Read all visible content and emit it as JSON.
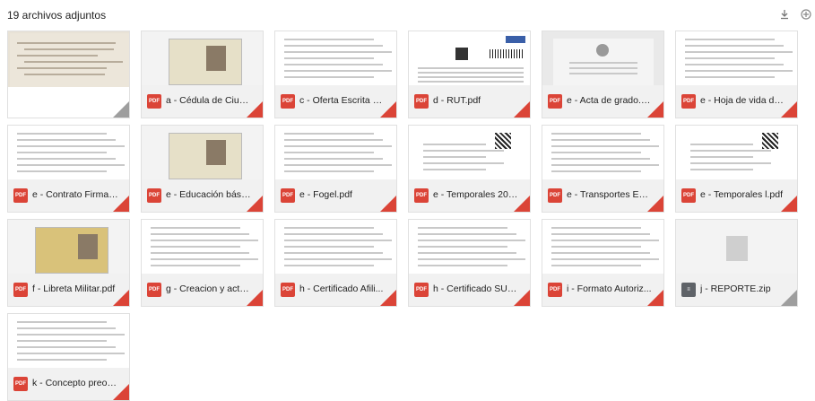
{
  "header": {
    "title": "19 archivos adjuntos",
    "download_icon": "download-icon",
    "drive_icon": "add-to-drive-icon"
  },
  "colors": {
    "pdf": "#db4437",
    "zip": "#5f6368",
    "card_bar": "#f1f1f1"
  },
  "attachments": [
    {
      "name": "",
      "type": "image",
      "thumb": "certificacion-bancaria"
    },
    {
      "name": "a - Cédula de Ciuda...",
      "type": "pdf",
      "thumb": "cedula"
    },
    {
      "name": "c - Oferta Escrita S...",
      "type": "pdf",
      "thumb": "doc"
    },
    {
      "name": "d - RUT.pdf",
      "type": "pdf",
      "thumb": "rut"
    },
    {
      "name": "e - Acta de grado.pdf",
      "type": "pdf",
      "thumb": "acta"
    },
    {
      "name": "e - Hoja de vida del...",
      "type": "pdf",
      "thumb": "form"
    },
    {
      "name": "e - Contrato Firmad...",
      "type": "pdf",
      "thumb": "form"
    },
    {
      "name": "e - Educación básic...",
      "type": "pdf",
      "thumb": "diploma"
    },
    {
      "name": "e - Fogel.pdf",
      "type": "pdf",
      "thumb": "doc"
    },
    {
      "name": "e - Temporales 202...",
      "type": "pdf",
      "thumb": "doc-qr"
    },
    {
      "name": "e - Transportes Esp...",
      "type": "pdf",
      "thumb": "doc"
    },
    {
      "name": "e - Temporales l.pdf",
      "type": "pdf",
      "thumb": "doc-qr"
    },
    {
      "name": "f - Libreta Militar.pdf",
      "type": "pdf",
      "thumb": "libreta"
    },
    {
      "name": "g - Creacion y actu...",
      "type": "pdf",
      "thumb": "form"
    },
    {
      "name": "h - Certificado Afili...",
      "type": "pdf",
      "thumb": "doc"
    },
    {
      "name": "h - Certificado SUR...",
      "type": "pdf",
      "thumb": "doc"
    },
    {
      "name": "i - Formato Autoriz...",
      "type": "pdf",
      "thumb": "doc"
    },
    {
      "name": "j - REPORTE.zip",
      "type": "zip",
      "thumb": "zip"
    },
    {
      "name": "k - Concepto preoc...",
      "type": "pdf",
      "thumb": "form"
    }
  ]
}
